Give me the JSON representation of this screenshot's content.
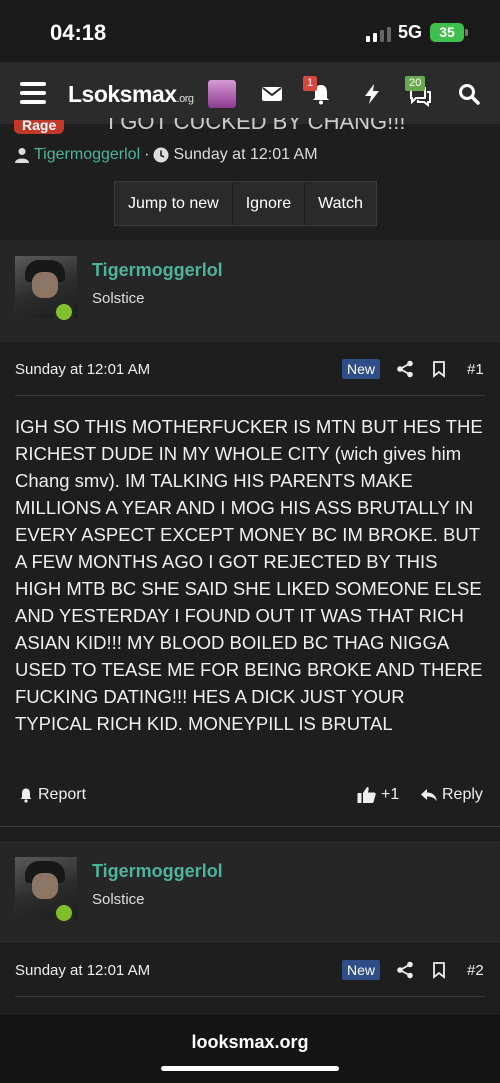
{
  "status_bar": {
    "time": "04:18",
    "network": "5G",
    "battery": "35"
  },
  "nav": {
    "logo_main": "Lsoksmax",
    "logo_suffix": ".org",
    "alerts_badge": "1",
    "conversations_badge": "20"
  },
  "thread": {
    "tag": "Rage",
    "title": "I GOT CUCKED BY CHANG!!!",
    "author": "Tigermoggerlol",
    "separator": "·",
    "date": "Sunday at 12:01 AM",
    "buttons": [
      "Jump to new",
      "Ignore",
      "Watch"
    ]
  },
  "posts": [
    {
      "username": "Tigermoggerlol",
      "user_title": "Solstice",
      "date": "Sunday at 12:01 AM",
      "badge": "New",
      "number": "#1",
      "body": "IGH SO THIS MOTHERFUCKER IS MTN BUT HES THE RICHEST DUDE IN MY WHOLE CITY (wich gives him Chang smv). IM TALKING HIS PARENTS MAKE MILLIONS A YEAR AND I MOG HIS ASS BRUTALLY IN EVERY ASPECT EXCEPT MONEY BC IM BROKE. BUT A FEW MONTHS AGO I GOT REJECTED BY THIS HIGH MTB BC SHE SAID SHE LIKED SOMEONE ELSE AND YESTERDAY I FOUND OUT IT WAS THAT RICH ASIAN KID!!! MY BLOOD BOILED BC THAG NIGGA USED TO TEASE ME FOR BEING BROKE AND THERE FUCKING DATING!!! HES A DICK JUST YOUR TYPICAL RICH KID. MONEYPILL IS BRUTAL",
      "report_label": "Report",
      "like_label": "+1",
      "reply_label": "Reply"
    },
    {
      "username": "Tigermoggerlol",
      "user_title": "Solstice",
      "date": "Sunday at 12:01 AM",
      "badge": "New",
      "number": "#2"
    }
  ],
  "browser": {
    "url": "looksmax.org"
  },
  "colors": {
    "accent_username": "#4fb39b",
    "new_badge": "#2f4d86",
    "alert_badge": "#d6463a",
    "online_dot": "#7fbf2a",
    "battery": "#3fbf4e"
  }
}
